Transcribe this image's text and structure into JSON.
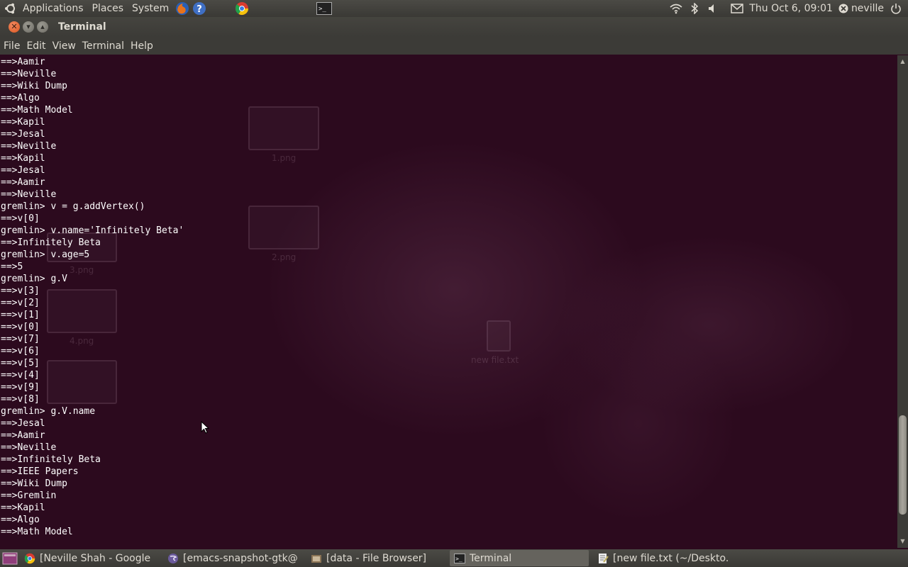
{
  "top_panel": {
    "menus": [
      "Applications",
      "Places",
      "System"
    ],
    "clock": "Thu Oct  6, 09:01",
    "user": "neville"
  },
  "window": {
    "title": "Terminal",
    "menus": [
      "File",
      "Edit",
      "View",
      "Terminal",
      "Help"
    ]
  },
  "terminal": {
    "lines": [
      "==>Aamir",
      "==>Neville",
      "==>Wiki Dump",
      "==>Algo",
      "==>Math Model",
      "==>Kapil",
      "==>Jesal",
      "==>Neville",
      "==>Kapil",
      "==>Jesal",
      "==>Aamir",
      "==>Neville",
      "gremlin> v = g.addVertex()",
      "==>v[0]",
      "gremlin> v.name='Infinitely Beta'",
      "==>Infinitely Beta",
      "gremlin> v.age=5",
      "==>5",
      "gremlin> g.V",
      "==>v[3]",
      "==>v[2]",
      "==>v[1]",
      "==>v[0]",
      "==>v[7]",
      "==>v[6]",
      "==>v[5]",
      "==>v[4]",
      "==>v[9]",
      "==>v[8]",
      "gremlin> g.V.name",
      "==>Jesal",
      "==>Aamir",
      "==>Neville",
      "==>Infinitely Beta",
      "==>IEEE Papers",
      "==>Wiki Dump",
      "==>Gremlin",
      "==>Kapil",
      "==>Algo",
      "==>Math Model"
    ],
    "background_files": [
      "1.png",
      "2.png",
      "3.png",
      "4.png",
      "new file.txt"
    ]
  },
  "taskbar": {
    "tasks": [
      {
        "label": "[Neville Shah - Google ...",
        "icon": "chrome-icon",
        "active": false
      },
      {
        "label": "[emacs-snapshot-gtk@...",
        "icon": "emacs-icon",
        "active": false
      },
      {
        "label": "[data - File Browser]",
        "icon": "file-browser-icon",
        "active": false
      },
      {
        "label": "Terminal",
        "icon": "terminal-icon",
        "active": true
      },
      {
        "label": "[new file.txt (~/Deskto...",
        "icon": "text-editor-icon",
        "active": false
      }
    ]
  }
}
